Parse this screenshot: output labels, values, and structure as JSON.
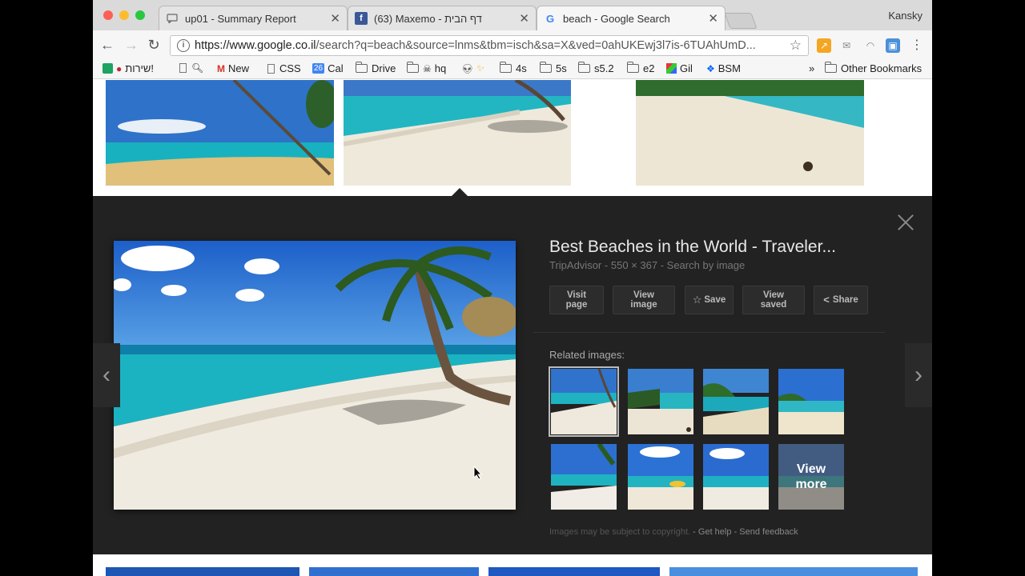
{
  "browser": {
    "profile_name": "Kansky",
    "tabs": [
      {
        "label": "up01 - Summary Report",
        "icon": "chat-bubble-icon"
      },
      {
        "label": "(63) Maxemo - דף הבית",
        "icon": "facebook-icon"
      },
      {
        "label": "beach - Google Search",
        "icon": "google-icon"
      }
    ],
    "url_host": "https://www.google.co.il",
    "url_path": "/search?q=beach&source=lnms&tbm=isch&sa=X&ved=0ahUKEwj3l7is-6TUAhUmD..."
  },
  "bookmarks": {
    "items": [
      {
        "label": "שירות!"
      },
      {
        "label": "New"
      },
      {
        "label": "CSS"
      },
      {
        "label": "Cal",
        "badge": "26"
      },
      {
        "label": "Drive"
      },
      {
        "label": "hq"
      },
      {
        "label": "4s"
      },
      {
        "label": "5s"
      },
      {
        "label": "s5.2"
      },
      {
        "label": "e2"
      },
      {
        "label": "Gil"
      },
      {
        "label": "BSM"
      }
    ],
    "overflow": "»",
    "other": "Other Bookmarks"
  },
  "panel": {
    "title": "Best Beaches in the World - Traveler...",
    "source": "TripAdvisor",
    "dimensions": "550 × 367",
    "search_by_image": "Search by image",
    "buttons": {
      "visit_line1": "Visit",
      "visit_line2": "page",
      "view_line1": "View",
      "view_line2": "image",
      "save": "Save",
      "saved_line1": "View",
      "saved_line2": "saved",
      "share": "Share"
    },
    "related_label": "Related images:",
    "view_more_line1": "View",
    "view_more_line2": "more",
    "footer_note": "Images may be subject to copyright.",
    "get_help": "Get help",
    "send_feedback": "Send feedback",
    "sep": "-"
  },
  "colors": {
    "panel_bg": "#222222",
    "sky": "#2a6ccf",
    "sea": "#1fb2c0",
    "sand": "#ece6d8"
  }
}
